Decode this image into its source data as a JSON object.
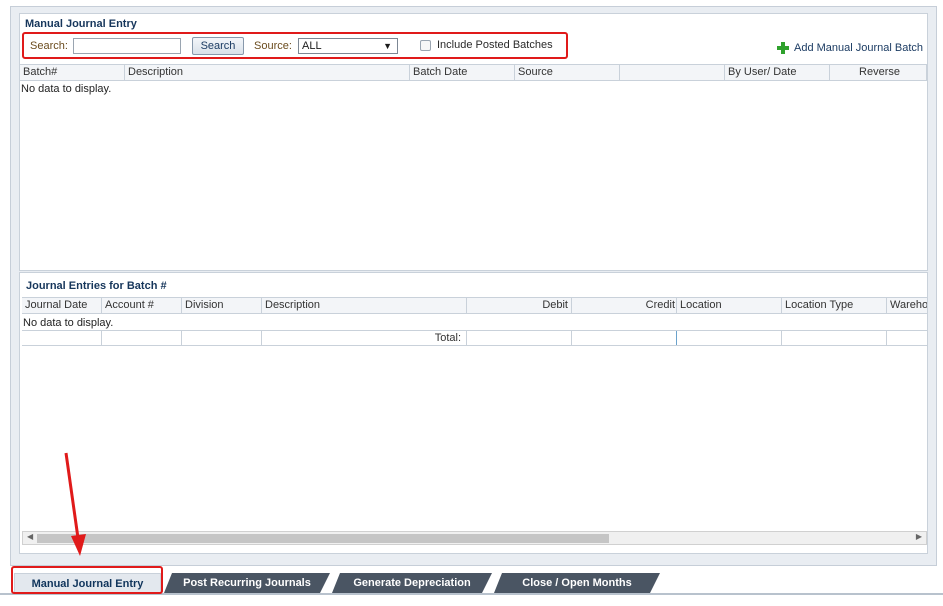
{
  "manual_panel": {
    "title": "Manual Journal Entry",
    "search_label": "Search:",
    "search_value": "",
    "search_button": "Search",
    "source_label": "Source:",
    "source_value": "ALL",
    "include_posted_label": "Include Posted Batches",
    "include_posted_checked": false,
    "add_batch_label": "Add Manual Journal Batch",
    "columns": [
      "Batch#",
      "Description",
      "Batch Date",
      "Source",
      "",
      "By User/ Date",
      "Reverse"
    ],
    "no_data": "No data to display."
  },
  "entries_panel": {
    "title": "Journal Entries for Batch #",
    "columns": [
      "Journal Date",
      "Account #",
      "Division",
      "Description",
      "Debit",
      "Credit",
      "Location",
      "Location Type",
      "Wareho"
    ],
    "no_data": "No data to display.",
    "total_label": "Total:"
  },
  "tabs": [
    {
      "label": "Manual Journal Entry",
      "active": true
    },
    {
      "label": "Post Recurring Journals",
      "active": false
    },
    {
      "label": "Generate Depreciation",
      "active": false
    },
    {
      "label": "Close / Open Months",
      "active": false
    }
  ],
  "colors": {
    "accent": "#16365b",
    "highlight": "#e01a1a",
    "tab": "#4a5563"
  },
  "icons": [
    "plus-icon",
    "chevron-down-icon",
    "chevron-left-icon",
    "chevron-right-icon",
    "arrow-icon"
  ]
}
